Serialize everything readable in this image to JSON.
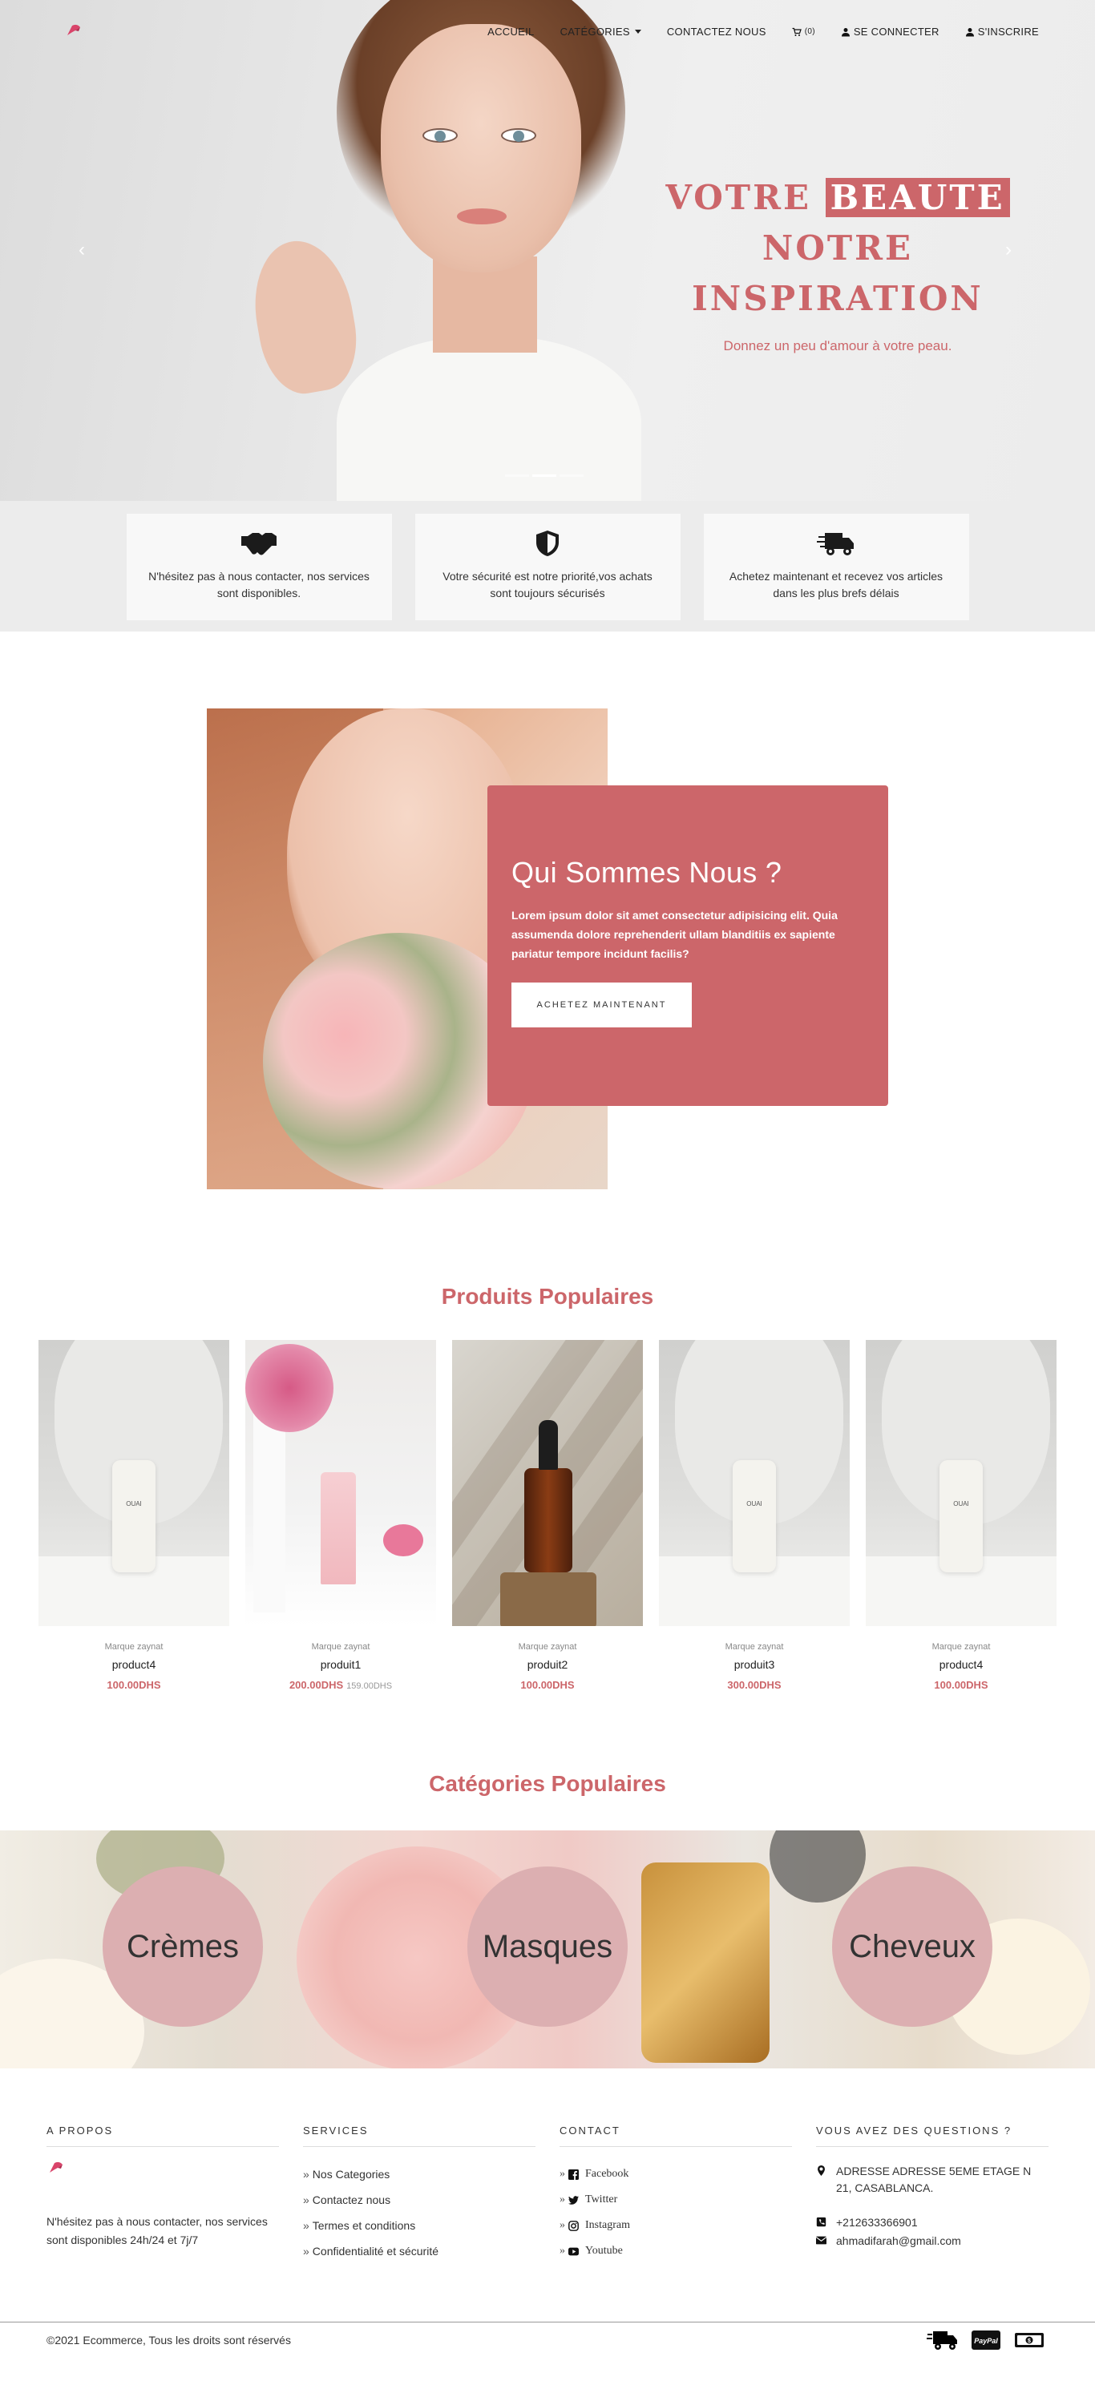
{
  "nav": {
    "links": {
      "home": "ACCUEIL",
      "categories": "CATÉGORIES",
      "contact": "CONTACTEZ NOUS",
      "cart_count": "(0)",
      "login": "SE CONNECTER",
      "register": "S'INSCRIRE"
    }
  },
  "hero": {
    "title_part1": "VOTRE ",
    "title_highlight": "BEAUTE",
    "title_line2": "NOTRE",
    "title_line3": "INSPIRATION",
    "subtitle": "Donnez un peu d'amour à votre peau.",
    "prev_arrow": "‹",
    "next_arrow": "›",
    "slide_count": 3,
    "active_slide": 2
  },
  "features": [
    {
      "icon": "handshake-icon",
      "text": "N'hésitez pas à nous contacter, nos services sont disponibles."
    },
    {
      "icon": "shield-icon",
      "text": "Votre sécurité est notre priorité,vos achats sont toujours sécurisés"
    },
    {
      "icon": "truck-icon",
      "text": "Achetez maintenant et recevez vos articles dans les plus brefs délais"
    }
  ],
  "about": {
    "title": "Qui Sommes Nous ?",
    "text": "Lorem ipsum dolor sit amet consectetur adipisicing elit. Quia assumenda dolore reprehenderit ullam blanditiis ex sapiente pariatur tempore incidunt facilis?",
    "button": "ACHETEZ MAINTENANT"
  },
  "products": {
    "title": "Produits Populaires",
    "items": [
      {
        "brand": "Marque zaynat",
        "name": "product4",
        "price": "100.00DHS",
        "old_price": "",
        "image": "ouai-bottle"
      },
      {
        "brand": "Marque zaynat",
        "name": "produit1",
        "price": "200.00DHS",
        "old_price": "159.00DHS",
        "image": "pink-tube"
      },
      {
        "brand": "Marque zaynat",
        "name": "produit2",
        "price": "100.00DHS",
        "old_price": "",
        "image": "dropper-bottle"
      },
      {
        "brand": "Marque zaynat",
        "name": "produit3",
        "price": "300.00DHS",
        "old_price": "",
        "image": "ouai-bottle"
      },
      {
        "brand": "Marque zaynat",
        "name": "product4",
        "price": "100.00DHS",
        "old_price": "",
        "image": "ouai-bottle"
      }
    ]
  },
  "categories": {
    "title": "Catégories Populaires",
    "items": [
      "Crèmes",
      "Masques",
      "Cheveux"
    ]
  },
  "footer": {
    "about": {
      "heading": "A PROPOS",
      "text": "N'hésitez pas à nous contacter, nos services sont disponibles 24h/24 et 7j/7"
    },
    "services": {
      "heading": "SERVICES",
      "items": [
        "Nos Categories",
        "Contactez nous",
        "Termes et conditions",
        "Confidentialité et sécurité"
      ]
    },
    "contact": {
      "heading": "CONTACT",
      "items": [
        "Facebook",
        "Twitter",
        "Instagram",
        "Youtube"
      ]
    },
    "questions": {
      "heading": "VOUS AVEZ DES QUESTIONS ?",
      "address": "ADRESSE ADRESSE 5EME ETAGE N 21, CASABLANCA.",
      "phone": "+212633366901",
      "email": "ahmadifarah@gmail.com"
    },
    "separator": "»",
    "copyright": "©2021 Ecommerce, Tous les droits sont réservés",
    "paypal_label": "PayPal"
  },
  "colors": {
    "accent": "#cc666a",
    "category_circle": "#dcafb1"
  }
}
